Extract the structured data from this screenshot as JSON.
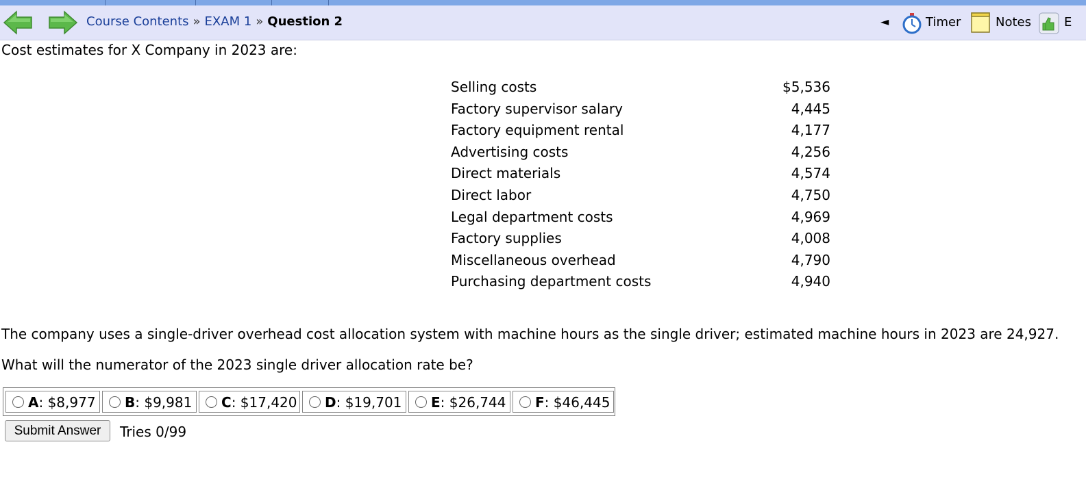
{
  "nav": {
    "breadcrumb": {
      "course_contents": "Course Contents",
      "exam": "EXAM 1",
      "current": "Question 2",
      "separator": "»"
    },
    "tools": {
      "collapse_glyph": "◄",
      "timer_label": "Timer",
      "notes_label": "Notes",
      "evaluate_label": "E"
    }
  },
  "question": {
    "intro": "Cost estimates for X Company in 2023 are:",
    "costs": [
      {
        "name": "Selling costs",
        "amount": "$5,536"
      },
      {
        "name": "Factory supervisor salary",
        "amount": "4,445"
      },
      {
        "name": "Factory equipment rental",
        "amount": "4,177"
      },
      {
        "name": "Advertising costs",
        "amount": "4,256"
      },
      {
        "name": "Direct materials",
        "amount": "4,574"
      },
      {
        "name": "Direct labor",
        "amount": "4,750"
      },
      {
        "name": "Legal department costs",
        "amount": "4,969"
      },
      {
        "name": "Factory supplies",
        "amount": "4,008"
      },
      {
        "name": "Miscellaneous overhead",
        "amount": "4,790"
      },
      {
        "name": "Purchasing department costs",
        "amount": "4,940"
      }
    ],
    "description": "The company uses a single-driver overhead cost allocation system with machine hours as the single driver; estimated machine hours in 2023 are 24,927.",
    "prompt": "What will the numerator of the 2023 single driver allocation rate be?"
  },
  "choices": [
    {
      "letter": "A",
      "value": ": $8,977"
    },
    {
      "letter": "B",
      "value": ": $9,981"
    },
    {
      "letter": "C",
      "value": ": $17,420"
    },
    {
      "letter": "D",
      "value": ": $19,701"
    },
    {
      "letter": "E",
      "value": ": $26,744"
    },
    {
      "letter": "F",
      "value": ": $46,445"
    }
  ],
  "submit_label": "Submit Answer",
  "tries": "Tries 0/99",
  "colors": {
    "nav_bg": "#e2e4f9",
    "link": "#1a3f99",
    "arrow_green": "#58b948"
  }
}
